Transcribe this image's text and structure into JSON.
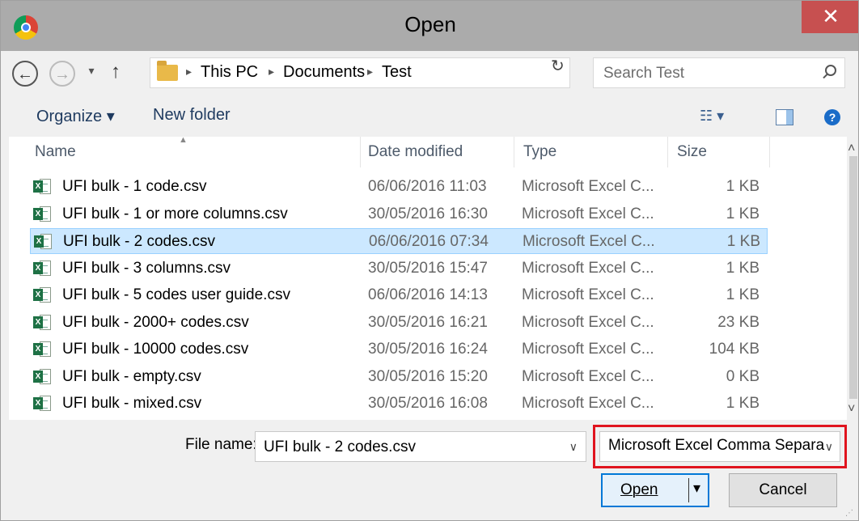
{
  "window": {
    "title": "Open",
    "close_glyph": "✕"
  },
  "nav": {
    "back_glyph": "←",
    "forward_glyph": "→",
    "recent_glyph": "▾",
    "up_glyph": "↑",
    "breadcrumbs": [
      "This PC",
      "Documents",
      "Test"
    ],
    "breadcrumb_separator": "▸",
    "dropdown_glyph": "∨",
    "refresh_glyph": "↻"
  },
  "search": {
    "placeholder": "Search Test"
  },
  "toolbar": {
    "organize_label": "Organize ▾",
    "new_folder_label": "New folder",
    "view_glyph": "☷ ▾",
    "help_glyph": "?"
  },
  "columns": {
    "name": "Name",
    "date": "Date modified",
    "type": "Type",
    "size": "Size"
  },
  "files": [
    {
      "name": "UFI bulk - 1 code.csv",
      "date": "06/06/2016 11:03",
      "type": "Microsoft Excel C...",
      "size": "1 KB"
    },
    {
      "name": "UFI bulk - 1 or more columns.csv",
      "date": "30/05/2016 16:30",
      "type": "Microsoft Excel C...",
      "size": "1 KB"
    },
    {
      "name": "UFI bulk - 2 codes.csv",
      "date": "06/06/2016 07:34",
      "type": "Microsoft Excel C...",
      "size": "1 KB",
      "selected": true
    },
    {
      "name": "UFI bulk - 3 columns.csv",
      "date": "30/05/2016 15:47",
      "type": "Microsoft Excel C...",
      "size": "1 KB"
    },
    {
      "name": "UFI bulk - 5 codes user guide.csv",
      "date": "06/06/2016 14:13",
      "type": "Microsoft Excel C...",
      "size": "1 KB"
    },
    {
      "name": "UFI bulk - 2000+ codes.csv",
      "date": "30/05/2016 16:21",
      "type": "Microsoft Excel C...",
      "size": "23 KB"
    },
    {
      "name": "UFI bulk - 10000 codes.csv",
      "date": "30/05/2016 16:24",
      "type": "Microsoft Excel C...",
      "size": "104 KB"
    },
    {
      "name": "UFI bulk - empty.csv",
      "date": "30/05/2016 15:20",
      "type": "Microsoft Excel C...",
      "size": "0 KB"
    },
    {
      "name": "UFI bulk - mixed.csv",
      "date": "30/05/2016 16:08",
      "type": "Microsoft Excel C...",
      "size": "1 KB"
    }
  ],
  "filename": {
    "label": "File name:",
    "value": "UFI bulk - 2 codes.csv",
    "dropdown_glyph": "∨"
  },
  "filetype": {
    "value": "Microsoft Excel Comma Separa",
    "dropdown_glyph": "∨"
  },
  "buttons": {
    "open": "Open",
    "open_dropdown_glyph": "▾",
    "cancel": "Cancel"
  },
  "colors": {
    "highlight": "#e0141e",
    "selection": "#cce8ff",
    "accent": "#0078d7"
  }
}
